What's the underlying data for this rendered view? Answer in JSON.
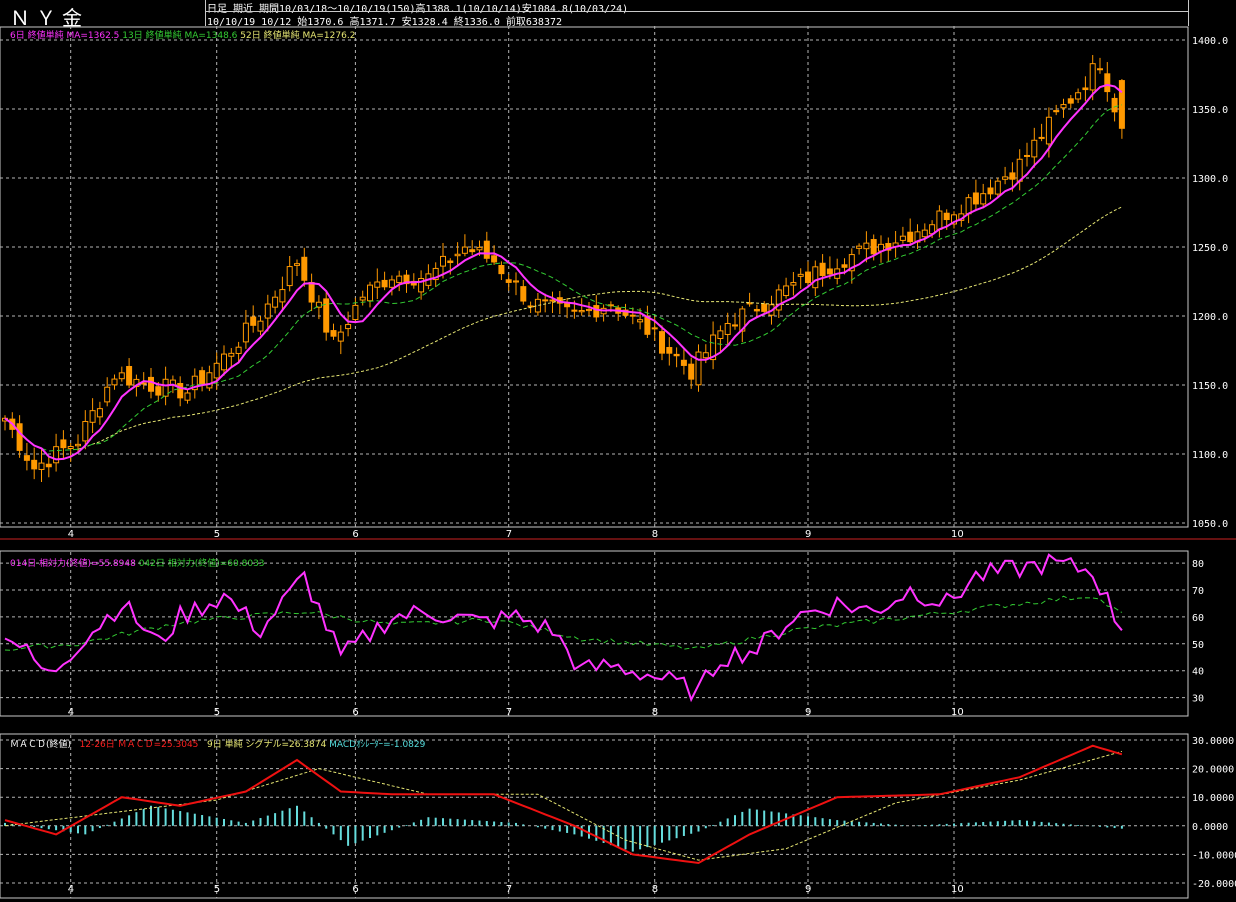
{
  "header": {
    "title": "ＮＹ金",
    "period_line": "日足 期近 期間10/03/18～10/10/19(150)高1388.1(10/10/14)安1084.8(10/03/24)",
    "bar_line": "10/10/19 10/12 始1370.6 高1371.7 安1328.4 終1336.0 前取638372"
  },
  "legends": {
    "price": [
      {
        "text": "6日 終値単純 MA=1362.5",
        "color": "#ff33ff"
      },
      {
        "text": "13日 終値単純 MA=1348.6",
        "color": "#33cc33"
      },
      {
        "text": "52日 終値単純 MA=1276.2",
        "color": "#e6e673"
      }
    ],
    "rsi": [
      {
        "text": "014日 相対力(終値)=55.8948",
        "color": "#ff33ff"
      },
      {
        "text": "042日 相対力(終値)=60.8033",
        "color": "#33cc33"
      }
    ],
    "macd": [
      {
        "text": "ＭＡＣＤ(終値)",
        "color": "#ffffff"
      },
      {
        "text": "12-26日 ＭＡＣＤ=25.3045",
        "color": "#ff2020"
      },
      {
        "text": "9日 単純 シグナル=26.3874",
        "color": "#e6e673"
      },
      {
        "text": "MACDｵｼﾚｰﾀｰ=-1.0829",
        "color": "#55dddd"
      }
    ]
  },
  "colors": {
    "candle": "#ff9900",
    "ma6": "#ff33ff",
    "ma13": "#33cc33",
    "ma52": "#e6e673",
    "rsi14": "#ff33ff",
    "rsi42": "#33cc33",
    "macd": "#ee1111",
    "signal": "#e6e673",
    "histogram": "#66dddd",
    "grid": "#b4b4b4"
  },
  "x_ticks": [
    "4",
    "5",
    "6",
    "7",
    "8",
    "9",
    "10"
  ],
  "chart_data": [
    {
      "type": "candlestick",
      "title": "ＮＹ金",
      "x_axis": "date (2010/03/18 - 2010/10/19), month ticks",
      "y_ticks": [
        "1400.0",
        "1350.0",
        "1300.0",
        "1250.0",
        "1200.0",
        "1150.0",
        "1100.0",
        "1050.0"
      ],
      "ylim": [
        1050,
        1400
      ],
      "close_anchors": {
        "dates": [
          "03-18",
          "03-24",
          "04-01",
          "04-08",
          "04-15",
          "04-22",
          "04-29",
          "05-06",
          "05-13",
          "05-20",
          "05-26",
          "06-01",
          "06-08",
          "06-15",
          "06-21",
          "06-28",
          "07-06",
          "07-13",
          "07-20",
          "07-28",
          "08-04",
          "08-11",
          "08-18",
          "08-25",
          "09-01",
          "09-08",
          "09-15",
          "09-22",
          "09-29",
          "10-06",
          "10-12",
          "10-14",
          "10-19"
        ],
        "close": [
          1126,
          1090,
          1110,
          1158,
          1150,
          1145,
          1170,
          1200,
          1240,
          1180,
          1215,
          1230,
          1228,
          1250,
          1240,
          1210,
          1200,
          1210,
          1190,
          1160,
          1195,
          1210,
          1225,
          1240,
          1250,
          1260,
          1275,
          1290,
          1310,
          1345,
          1370,
          1385,
          1336
        ]
      },
      "series": [
        {
          "name": "6日 終値単純",
          "last": 1362.5
        },
        {
          "name": "13日 終値単純",
          "last": 1348.6
        },
        {
          "name": "52日 終値単純",
          "last": 1276.2
        }
      ],
      "high": 1388.1,
      "high_date": "10/10/14",
      "low": 1084.8,
      "low_date": "10/03/24"
    },
    {
      "type": "line",
      "title": "相対力",
      "y_ticks": [
        "80",
        "70",
        "60",
        "50",
        "40",
        "30"
      ],
      "ylim": [
        30,
        85
      ],
      "series": [
        {
          "name": "014日 相対力(終値)",
          "last": 55.8948,
          "anchors_x": [
            "03-18",
            "03-26",
            "04-01",
            "04-09",
            "04-16",
            "04-21",
            "04-29",
            "05-06",
            "05-14",
            "05-21",
            "06-01",
            "06-08",
            "06-17",
            "06-24",
            "07-01",
            "07-07",
            "07-13",
            "07-21",
            "07-29",
            "08-03",
            "08-10",
            "08-17",
            "08-25",
            "09-01",
            "09-08",
            "09-15",
            "09-21",
            "09-29",
            "10-05",
            "10-13",
            "10-19"
          ],
          "anchors_y": [
            55,
            38,
            50,
            65,
            50,
            60,
            68,
            55,
            75,
            45,
            60,
            62,
            58,
            60,
            55,
            40,
            42,
            38,
            32,
            45,
            48,
            60,
            65,
            62,
            70,
            65,
            75,
            78,
            80,
            77,
            55
          ]
        },
        {
          "name": "042日 相対力(終値)",
          "last": 60.8033,
          "anchors_x": [
            "03-18",
            "04-01",
            "04-21",
            "05-14",
            "06-01",
            "06-21",
            "07-07",
            "07-29",
            "08-17",
            "09-08",
            "09-29",
            "10-13",
            "10-19"
          ],
          "anchors_y": [
            48,
            50,
            58,
            62,
            57,
            59,
            52,
            48,
            55,
            60,
            65,
            68,
            61
          ]
        }
      ]
    },
    {
      "type": "line+bar",
      "title": "ＭＡＣＤ(終値)",
      "y_ticks": [
        "30.0000",
        "20.0000",
        "10.0000",
        "0.0000",
        "-10.0000",
        "-20.0000"
      ],
      "ylim": [
        -21,
        31
      ],
      "series": [
        {
          "name": "12-26日 ＭＡＣＤ",
          "last": 25.3045,
          "anchors_x": [
            "03-18",
            "03-29",
            "04-09",
            "04-21",
            "05-04",
            "05-13",
            "05-21",
            "06-01",
            "06-21",
            "07-06",
            "07-16",
            "07-29",
            "08-09",
            "08-25",
            "09-14",
            "09-29",
            "10-13",
            "10-19"
          ],
          "anchors_y": [
            2,
            -3,
            10,
            7,
            12,
            23,
            12,
            11,
            11,
            0,
            -10,
            -13,
            -3,
            10,
            11,
            17,
            28,
            25
          ]
        },
        {
          "name": "9日 単純 シグナル",
          "last": 26.3874,
          "anchors_x": [
            "03-18",
            "04-09",
            "04-28",
            "05-18",
            "06-08",
            "06-29",
            "07-15",
            "07-29",
            "08-16",
            "09-06",
            "09-29",
            "10-19"
          ],
          "anchors_y": [
            0,
            5,
            9,
            20,
            11,
            11,
            -5,
            -12,
            -8,
            8,
            16,
            26
          ]
        },
        {
          "name": "MACDｵｼﾚｰﾀｰ",
          "last": -1.0829,
          "anchors_x": [
            "03-18",
            "04-02",
            "04-15",
            "05-04",
            "05-13",
            "05-24",
            "06-08",
            "06-24",
            "07-06",
            "07-16",
            "07-29",
            "08-09",
            "08-25",
            "09-08",
            "09-29",
            "10-19"
          ],
          "anchors_y": [
            1,
            -3,
            7,
            1,
            7,
            -7,
            3,
            1,
            -3,
            -9,
            -2,
            6,
            2,
            0,
            2,
            -1
          ]
        }
      ]
    }
  ]
}
